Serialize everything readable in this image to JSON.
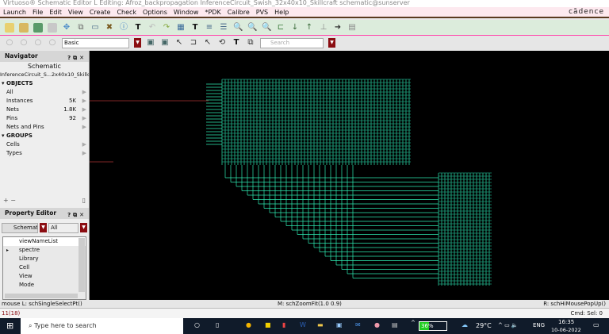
{
  "window": {
    "title": "Virtuoso® Schematic Editor L Editing: Afroz_backpropagation InferenceCircuit_Swish_32x40x10_Skillcraft schematic@sunserver",
    "brand": "cādence"
  },
  "menu": [
    "Launch",
    "File",
    "Edit",
    "View",
    "Create",
    "Check",
    "Options",
    "Window",
    "*PDK",
    "Calibre",
    "PVS",
    "Help"
  ],
  "toolbar2": {
    "mode": "Basic",
    "search_placeholder": "Search"
  },
  "navigator": {
    "title": "Navigator",
    "view": "Schematic",
    "cell": "InferenceCircuit_S...2x40x10_Skillcraft",
    "objects_label": "OBJECTS",
    "objects": [
      {
        "label": "All",
        "value": ""
      },
      {
        "label": "Instances",
        "value": "5K"
      },
      {
        "label": "Nets",
        "value": "1.8K"
      },
      {
        "label": "Pins",
        "value": "92"
      },
      {
        "label": "Nets and Pins",
        "value": ""
      }
    ],
    "groups_label": "GROUPS",
    "groups": [
      {
        "label": "Cells"
      },
      {
        "label": "Types"
      }
    ]
  },
  "property_editor": {
    "title": "Property Editor",
    "type": "Schematic",
    "filter": "All",
    "rows": [
      "viewNameList",
      "spectre",
      "Library",
      "Cell",
      "View",
      "Mode"
    ]
  },
  "status": {
    "left": "mouse L: schSingleSelectPt()",
    "middle": "M: schZoomFit(1.0 0.9)",
    "right": "R: schHiMousePopUp()"
  },
  "cmdline": {
    "prompt": "11(18)",
    "cmd": "Cmd:",
    "sel": "Sel: 0"
  },
  "taskbar": {
    "search": "Type here to search",
    "battery": "36%",
    "weather": "29°C",
    "lang": "ENG",
    "time": "16:35",
    "date": "10-06-2022"
  },
  "colors": {
    "wire": "#2ee8b0",
    "canvas": "#000000",
    "accent": "#8b0d12"
  }
}
